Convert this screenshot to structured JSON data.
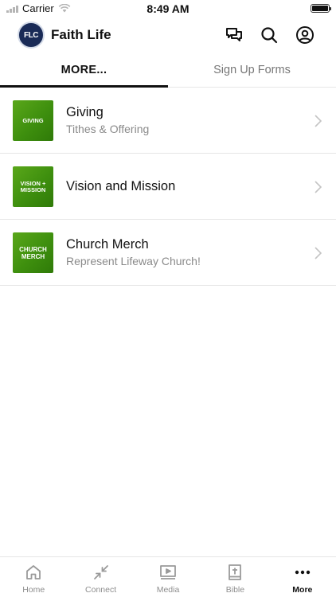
{
  "status_bar": {
    "carrier": "Carrier",
    "time": "8:49 AM"
  },
  "header": {
    "logo_text": "FLC",
    "title": "Faith Life",
    "icons": [
      "chat-icon",
      "search-icon",
      "profile-icon"
    ]
  },
  "tabs": [
    {
      "label": "MORE...",
      "active": true
    },
    {
      "label": "Sign Up Forms",
      "active": false
    }
  ],
  "items": [
    {
      "thumb_text": "GIVING",
      "title": "Giving",
      "subtitle": "Tithes & Offering"
    },
    {
      "thumb_text": "VISION + MISSION",
      "title": "Vision and Mission",
      "subtitle": ""
    },
    {
      "thumb_text": "CHURCH MERCH",
      "title": "Church Merch",
      "subtitle": "Represent Lifeway Church!"
    }
  ],
  "bottom_nav": [
    {
      "label": "Home",
      "icon": "home-icon",
      "active": false
    },
    {
      "label": "Connect",
      "icon": "connect-icon",
      "active": false
    },
    {
      "label": "Media",
      "icon": "media-icon",
      "active": false
    },
    {
      "label": "Bible",
      "icon": "bible-icon",
      "active": false
    },
    {
      "label": "More",
      "icon": "more-icon",
      "active": true
    }
  ],
  "colors": {
    "accent_green": "#3e8f0e",
    "logo_navy": "#1a2b57",
    "active_text": "#111111",
    "inactive_text": "#8e8e8e"
  }
}
